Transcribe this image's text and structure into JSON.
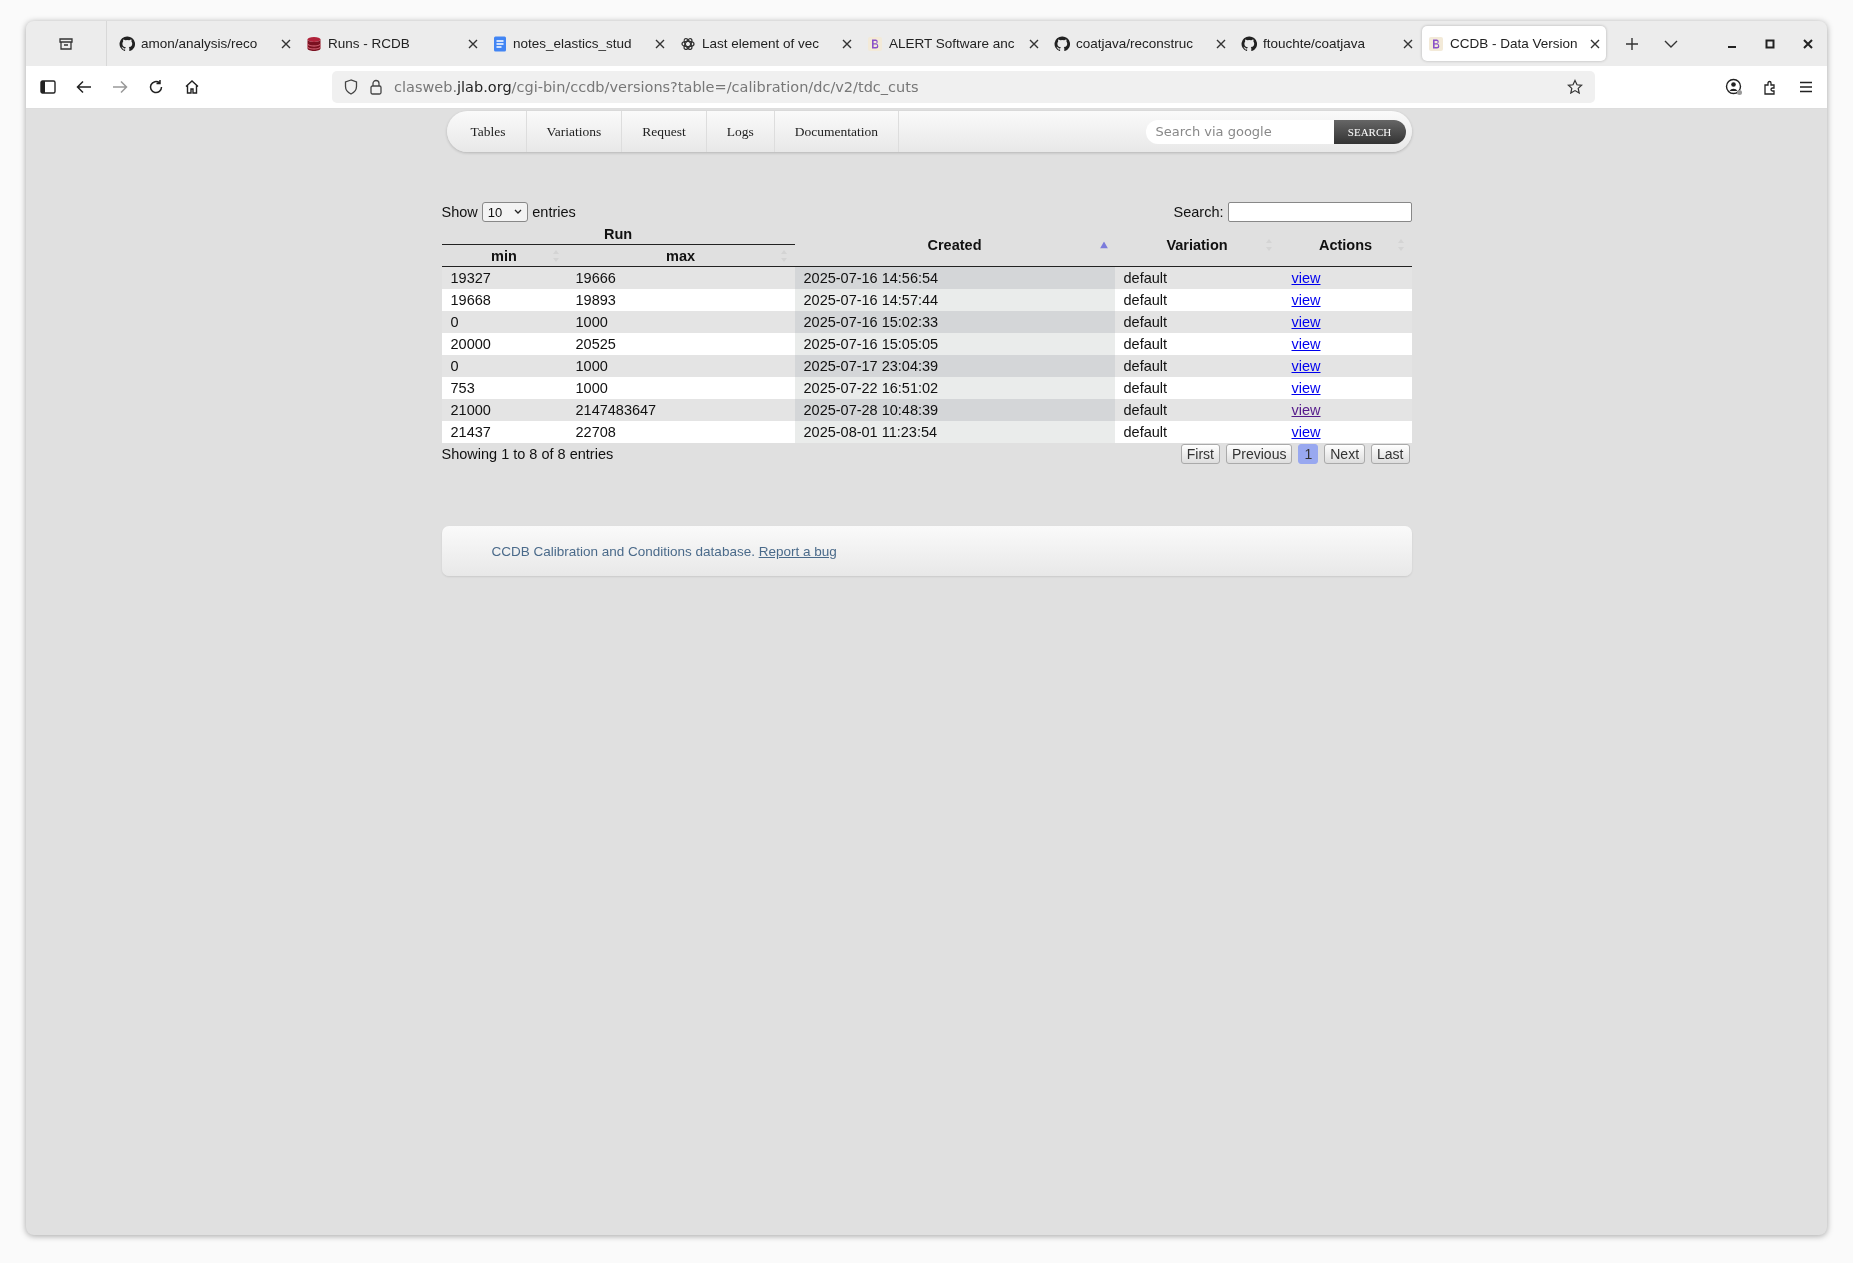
{
  "browser": {
    "tabs": [
      {
        "title": "amon/analysis/reco",
        "kind": "github",
        "selected": false
      },
      {
        "title": "Runs - RCDB",
        "kind": "database",
        "selected": false
      },
      {
        "title": "notes_elastics_stud",
        "kind": "document",
        "selected": false
      },
      {
        "title": "Last element of vec",
        "kind": "knot",
        "selected": false
      },
      {
        "title": "ALERT Software anc",
        "kind": "bootstrap",
        "selected": false
      },
      {
        "title": "coatjava/reconstruc",
        "kind": "github",
        "selected": false
      },
      {
        "title": "ftouchte/coatjava",
        "kind": "github",
        "selected": false
      },
      {
        "title": "CCDB - Data Version",
        "kind": "bootstrap",
        "selected": true
      }
    ],
    "url_host_prefix": "clasweb.",
    "url_host": "jlab.org",
    "url_path": "/cgi-bin/ccdb/versions?table=/calibration/dc/v2/tdc_cuts"
  },
  "nav": {
    "items": [
      "Tables",
      "Variations",
      "Request",
      "Logs",
      "Documentation"
    ],
    "search_placeholder": "Search via google",
    "search_button": "SEARCH"
  },
  "table": {
    "show_label": "Show",
    "page_size": "10",
    "entries_label": "entries",
    "search_label": "Search:",
    "group_header": "Run",
    "columns": [
      {
        "label": "min",
        "sorted": false
      },
      {
        "label": "max",
        "sorted": false
      },
      {
        "label": "Created",
        "sorted": true
      },
      {
        "label": "Variation",
        "sorted": false
      },
      {
        "label": "Actions",
        "sorted": false
      }
    ],
    "rows": [
      {
        "min": "19327",
        "max": "19666",
        "created": "2025-07-16 14:56:54",
        "variation": "default",
        "action": "view",
        "visited": false
      },
      {
        "min": "19668",
        "max": "19893",
        "created": "2025-07-16 14:57:44",
        "variation": "default",
        "action": "view",
        "visited": false
      },
      {
        "min": "0",
        "max": "1000",
        "created": "2025-07-16 15:02:33",
        "variation": "default",
        "action": "view",
        "visited": false
      },
      {
        "min": "20000",
        "max": "20525",
        "created": "2025-07-16 15:05:05",
        "variation": "default",
        "action": "view",
        "visited": false
      },
      {
        "min": "0",
        "max": "1000",
        "created": "2025-07-17 23:04:39",
        "variation": "default",
        "action": "view",
        "visited": false
      },
      {
        "min": "753",
        "max": "1000",
        "created": "2025-07-22 16:51:02",
        "variation": "default",
        "action": "view",
        "visited": false
      },
      {
        "min": "21000",
        "max": "2147483647",
        "created": "2025-07-28 10:48:39",
        "variation": "default",
        "action": "view",
        "visited": true
      },
      {
        "min": "21437",
        "max": "22708",
        "created": "2025-08-01 11:23:54",
        "variation": "default",
        "action": "view",
        "visited": false
      }
    ],
    "info": "Showing 1 to 8 of 8 entries",
    "pager": [
      {
        "label": "First",
        "selected": false
      },
      {
        "label": "Previous",
        "selected": false
      },
      {
        "label": "1",
        "selected": true
      },
      {
        "label": "Next",
        "selected": false
      },
      {
        "label": "Last",
        "selected": false
      }
    ]
  },
  "footer": {
    "text": "CCDB Calibration and Conditions database.",
    "link": "Report a bug"
  }
}
